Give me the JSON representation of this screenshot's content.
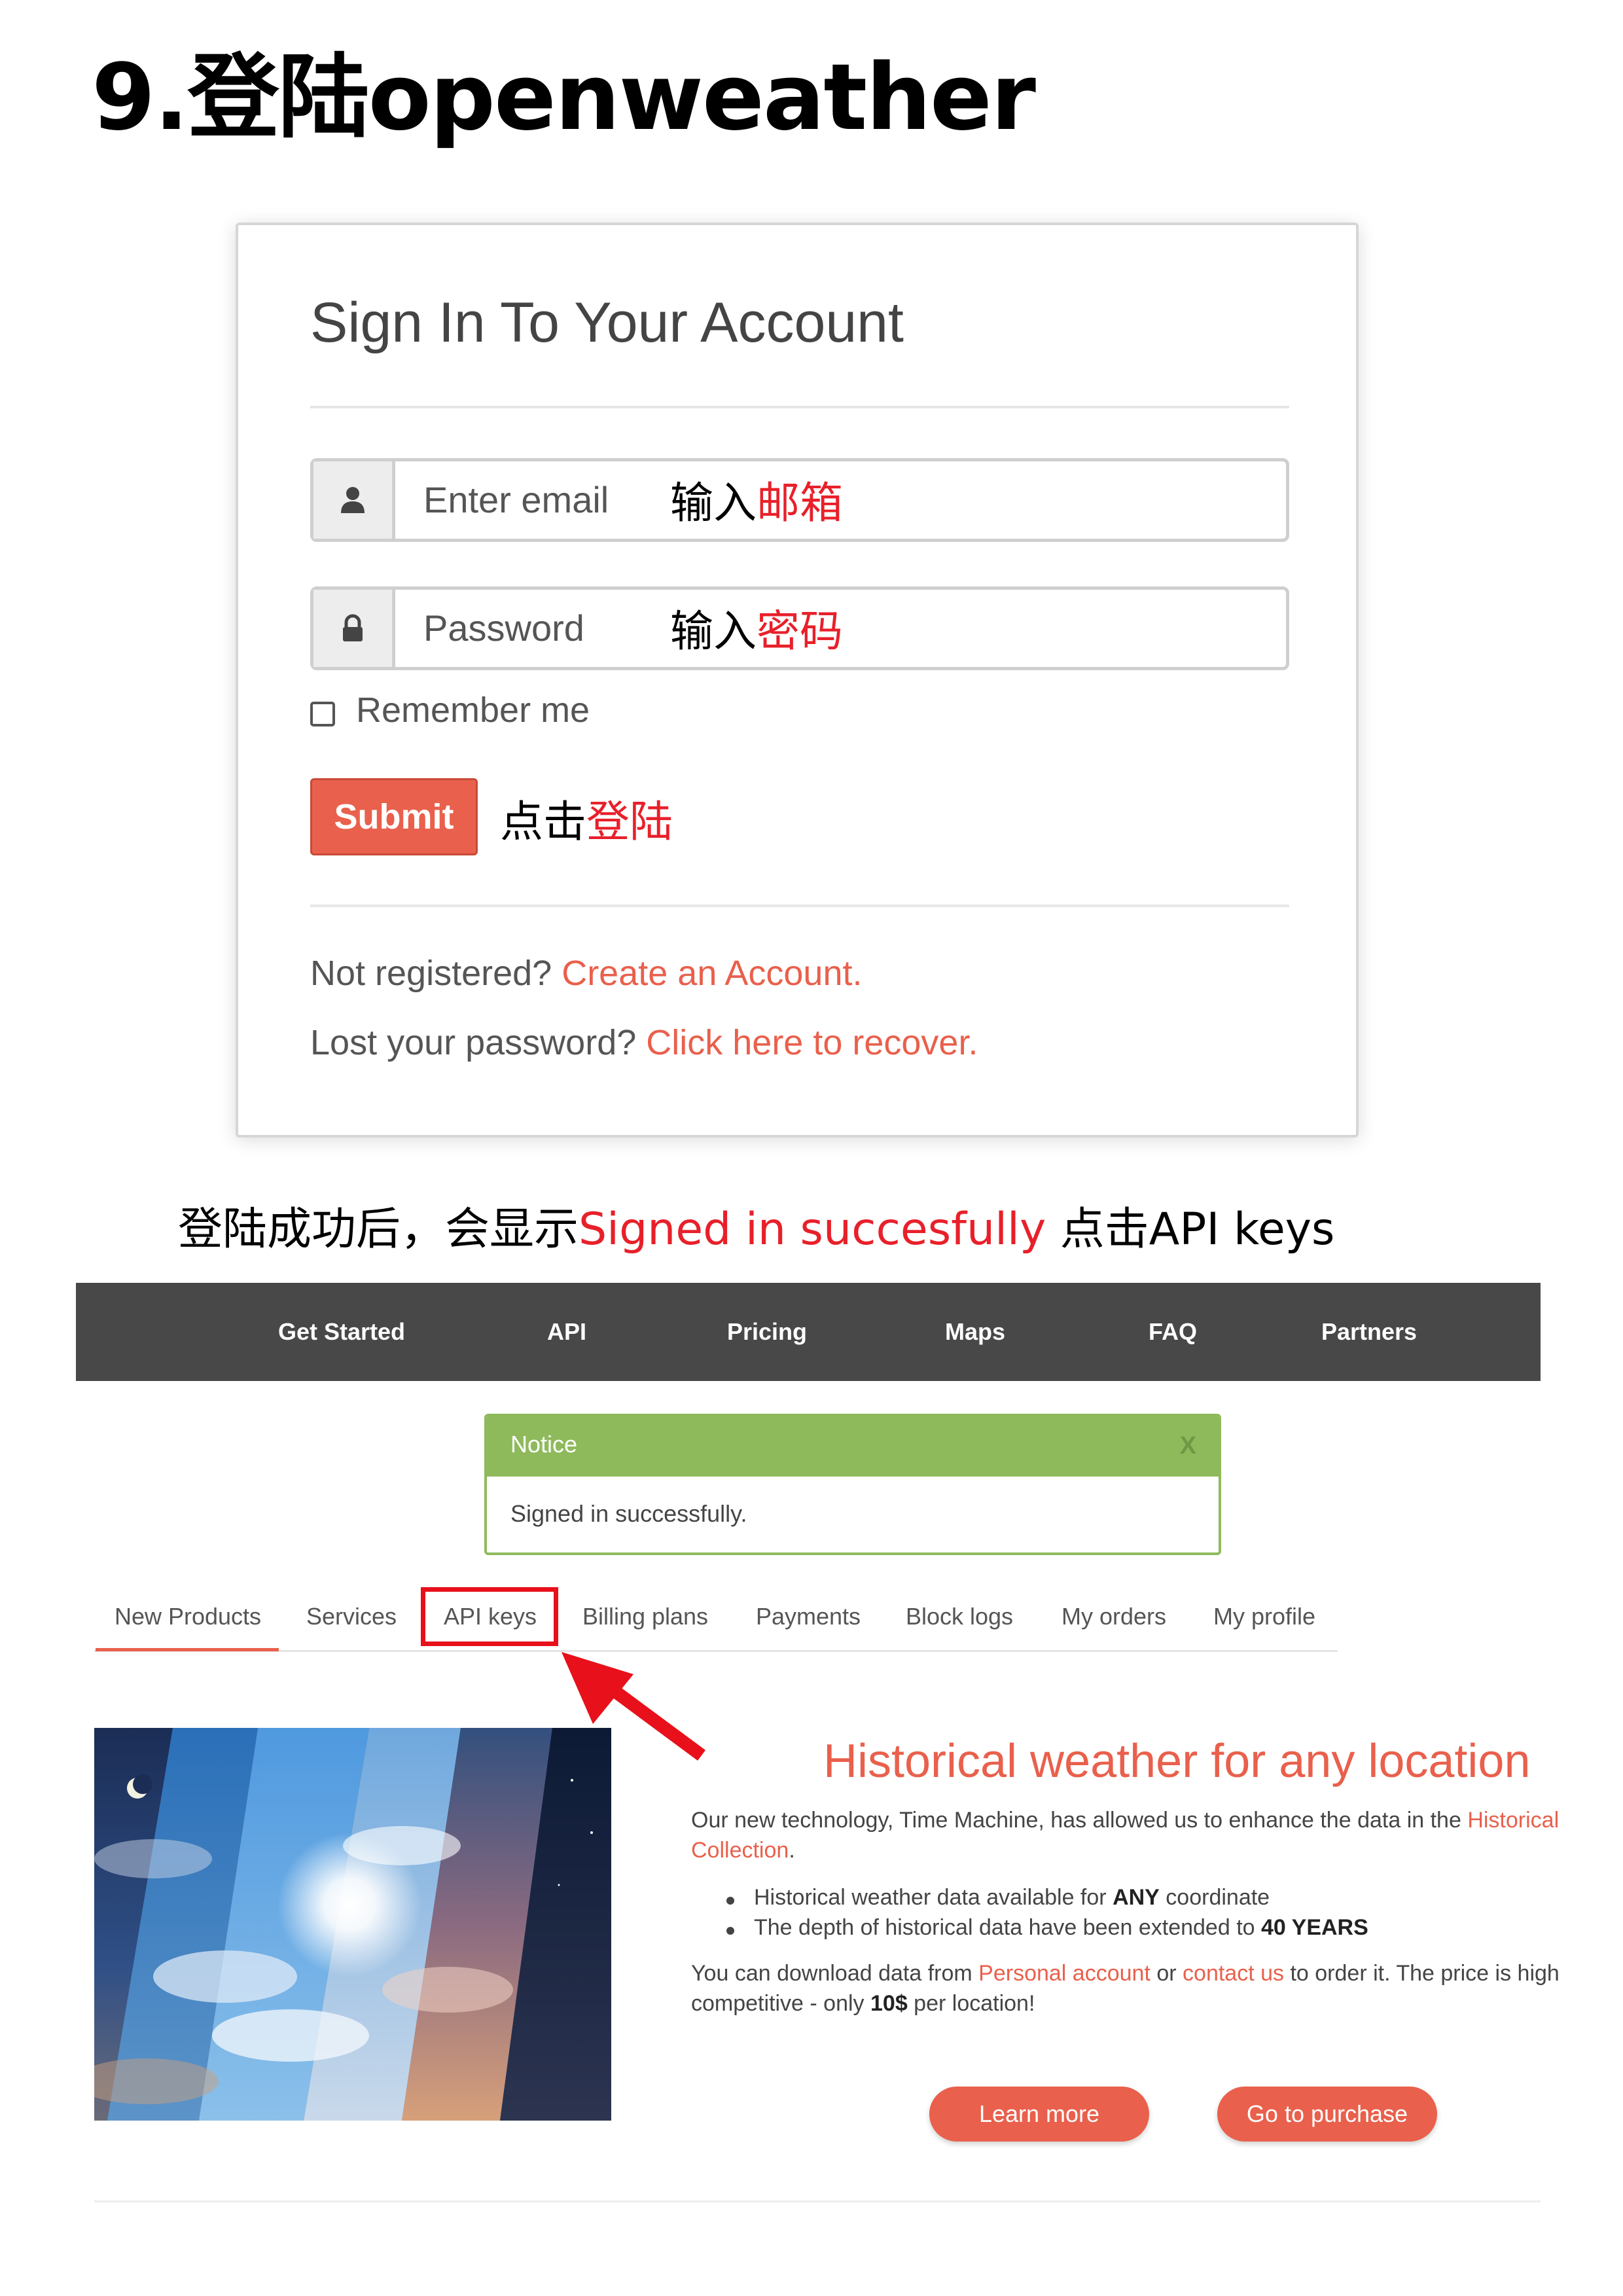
{
  "heading": "9.登陆openweather",
  "signin": {
    "title": "Sign In To Your Account",
    "email_placeholder": "Enter email",
    "email_note_prefix": "输入",
    "email_note_highlight": "邮箱",
    "password_placeholder": "Password",
    "password_note_prefix": "输入",
    "password_note_highlight": "密码",
    "remember_label": "Remember me",
    "submit_label": "Submit",
    "submit_note_prefix": "点击",
    "submit_note_highlight": "登陆",
    "not_registered_text": "Not registered? ",
    "create_account_link": "Create an Account.",
    "lost_password_text": "Lost your password? ",
    "recover_link": "Click here to recover."
  },
  "caption": {
    "prefix": "登陆成功后，会显示",
    "highlight": "Signed in succesfully",
    "suffix": " 点击API keys"
  },
  "navbar": {
    "items": [
      "Get Started",
      "API",
      "Pricing",
      "Maps",
      "FAQ",
      "Partners"
    ]
  },
  "notice": {
    "title": "Notice",
    "close": "X",
    "message": "Signed in successfully."
  },
  "tabs": [
    "New Products",
    "Services",
    "API keys",
    "Billing plans",
    "Payments",
    "Block logs",
    "My orders",
    "My profile"
  ],
  "tabs_active": "New Products",
  "tabs_highlighted": "API keys",
  "promo": {
    "title": "Historical weather for any location",
    "intro_prefix": "Our new technology, Time Machine, has allowed us to enhance the data in the ",
    "intro_link": "Historical",
    "intro_link_2": "Collection",
    "intro_end": ".",
    "bullet1_prefix": "Historical weather data available for ",
    "bullet1_bold": "ANY",
    "bullet1_suffix": " coordinate",
    "bullet2_prefix": "The depth of historical data have been extended to ",
    "bullet2_bold": "40 YEARS",
    "download_prefix": "You can download data from ",
    "download_link1": "Personal account",
    "download_or": " or ",
    "download_link2": "contact us",
    "download_suffix": " to order it. The price is high",
    "download_line2_prefix": "competitive - only ",
    "download_line2_bold": "10$",
    "download_line2_suffix": " per location!",
    "learn_more": "Learn more",
    "purchase": "Go to purchase"
  },
  "colors": {
    "accent": "#e9604c",
    "annotation_red": "#e8202a",
    "navbar_bg": "#484848",
    "notice_green": "#8fba5c"
  }
}
